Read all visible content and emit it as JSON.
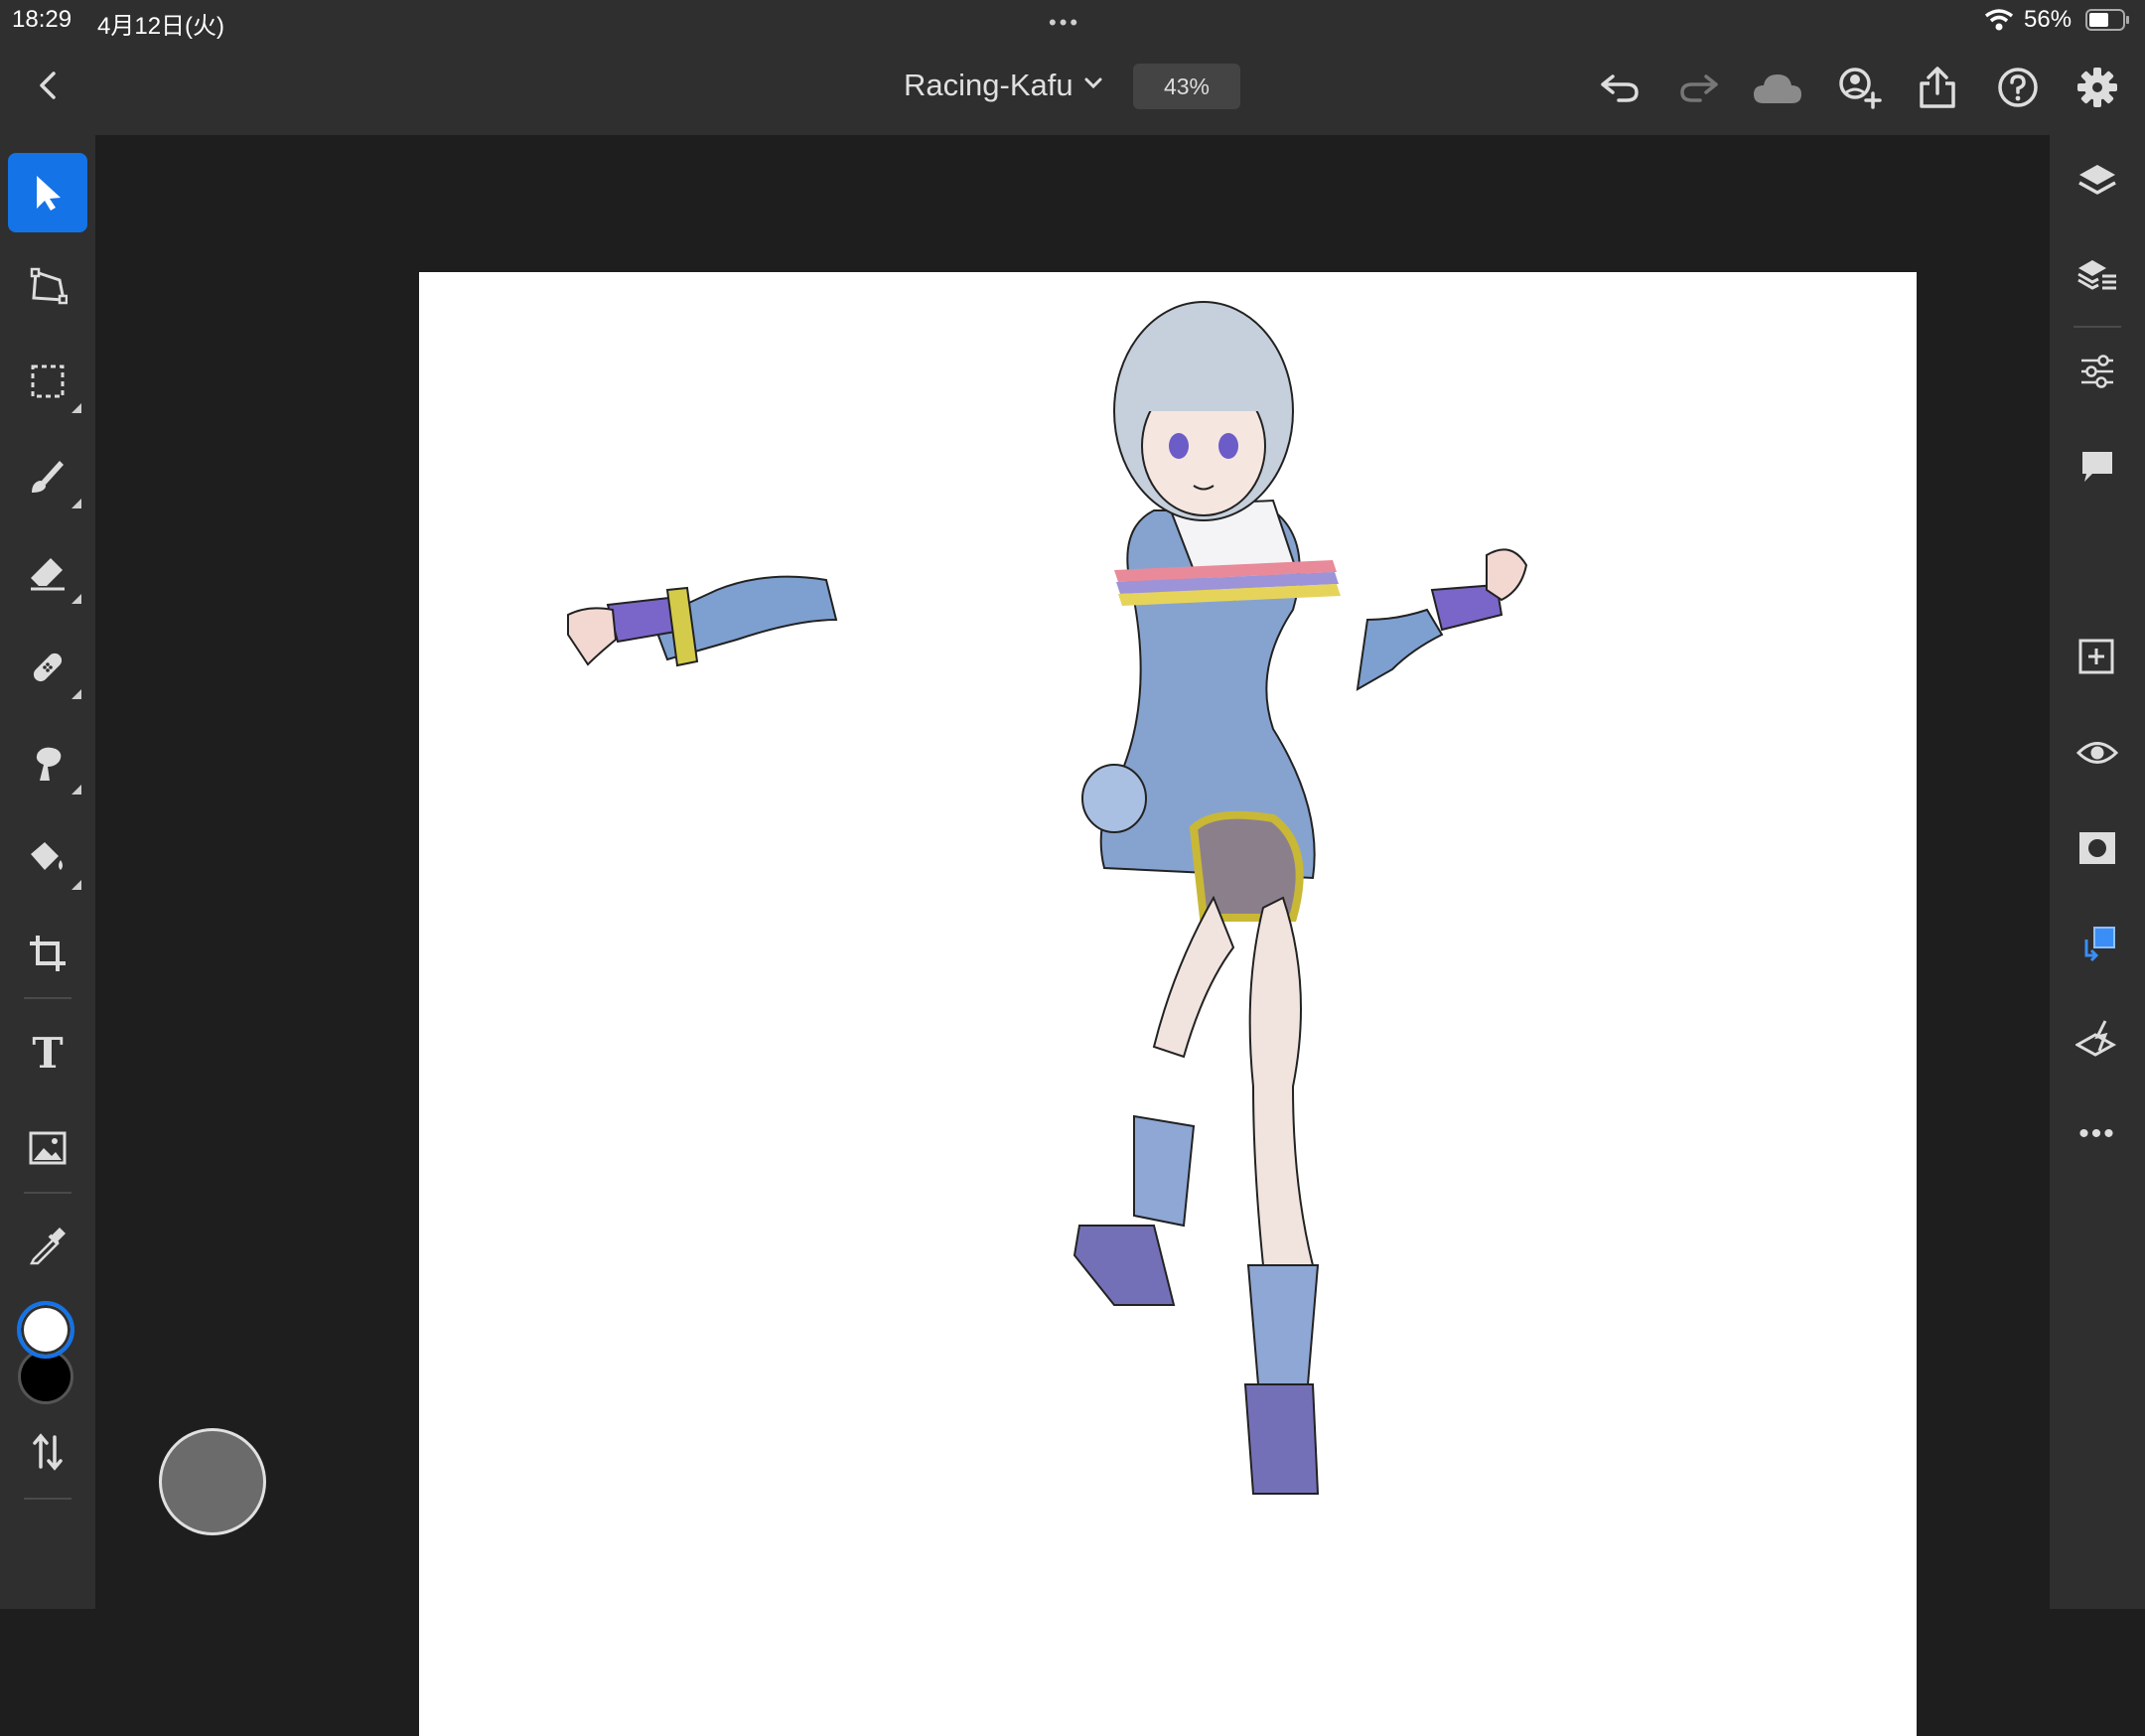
{
  "status_bar": {
    "time": "18:29",
    "date": "4月12日(火)",
    "battery_percent": "56%",
    "multitask_dots": "•••"
  },
  "toolbar": {
    "document_title": "Racing-Kafu",
    "zoom_level": "43%",
    "icons": [
      "back-icon",
      "chevron-down-icon",
      "undo-icon",
      "redo-icon",
      "cloud-icon",
      "invite-icon",
      "share-icon",
      "help-icon",
      "settings-icon"
    ]
  },
  "left_tools": {
    "items": [
      {
        "name": "select-tool",
        "icon": "arrow-pointer-icon",
        "active": true
      },
      {
        "name": "transform-tool",
        "icon": "transform-icon"
      },
      {
        "name": "marquee-tool",
        "icon": "marquee-icon"
      },
      {
        "name": "brush-tool",
        "icon": "brush-icon"
      },
      {
        "name": "eraser-tool",
        "icon": "eraser-icon"
      },
      {
        "name": "healing-tool",
        "icon": "bandage-icon"
      },
      {
        "name": "smudge-tool",
        "icon": "smudge-icon"
      },
      {
        "name": "fill-tool",
        "icon": "paint-bucket-icon"
      },
      {
        "name": "crop-tool",
        "icon": "crop-icon"
      },
      {
        "name": "type-tool",
        "icon": "type-icon",
        "label": "T"
      },
      {
        "name": "place-image-tool",
        "icon": "image-icon"
      },
      {
        "name": "eyedropper-tool",
        "icon": "eyedropper-icon"
      },
      {
        "name": "swap-colors",
        "icon": "swap-arrows-icon"
      }
    ],
    "foreground_color": "#ffffff",
    "background_color": "#000000",
    "accent_color": "#1473e6"
  },
  "right_panel": {
    "items": [
      "layers-icon",
      "layer-properties-icon",
      "adjustments-icon",
      "comments-icon",
      "add-layer-icon",
      "visibility-icon",
      "mask-icon",
      "clipping-icon",
      "fx-icon",
      "more-icon"
    ],
    "more_label": "•••"
  },
  "canvas": {
    "background": "#ffffff"
  }
}
